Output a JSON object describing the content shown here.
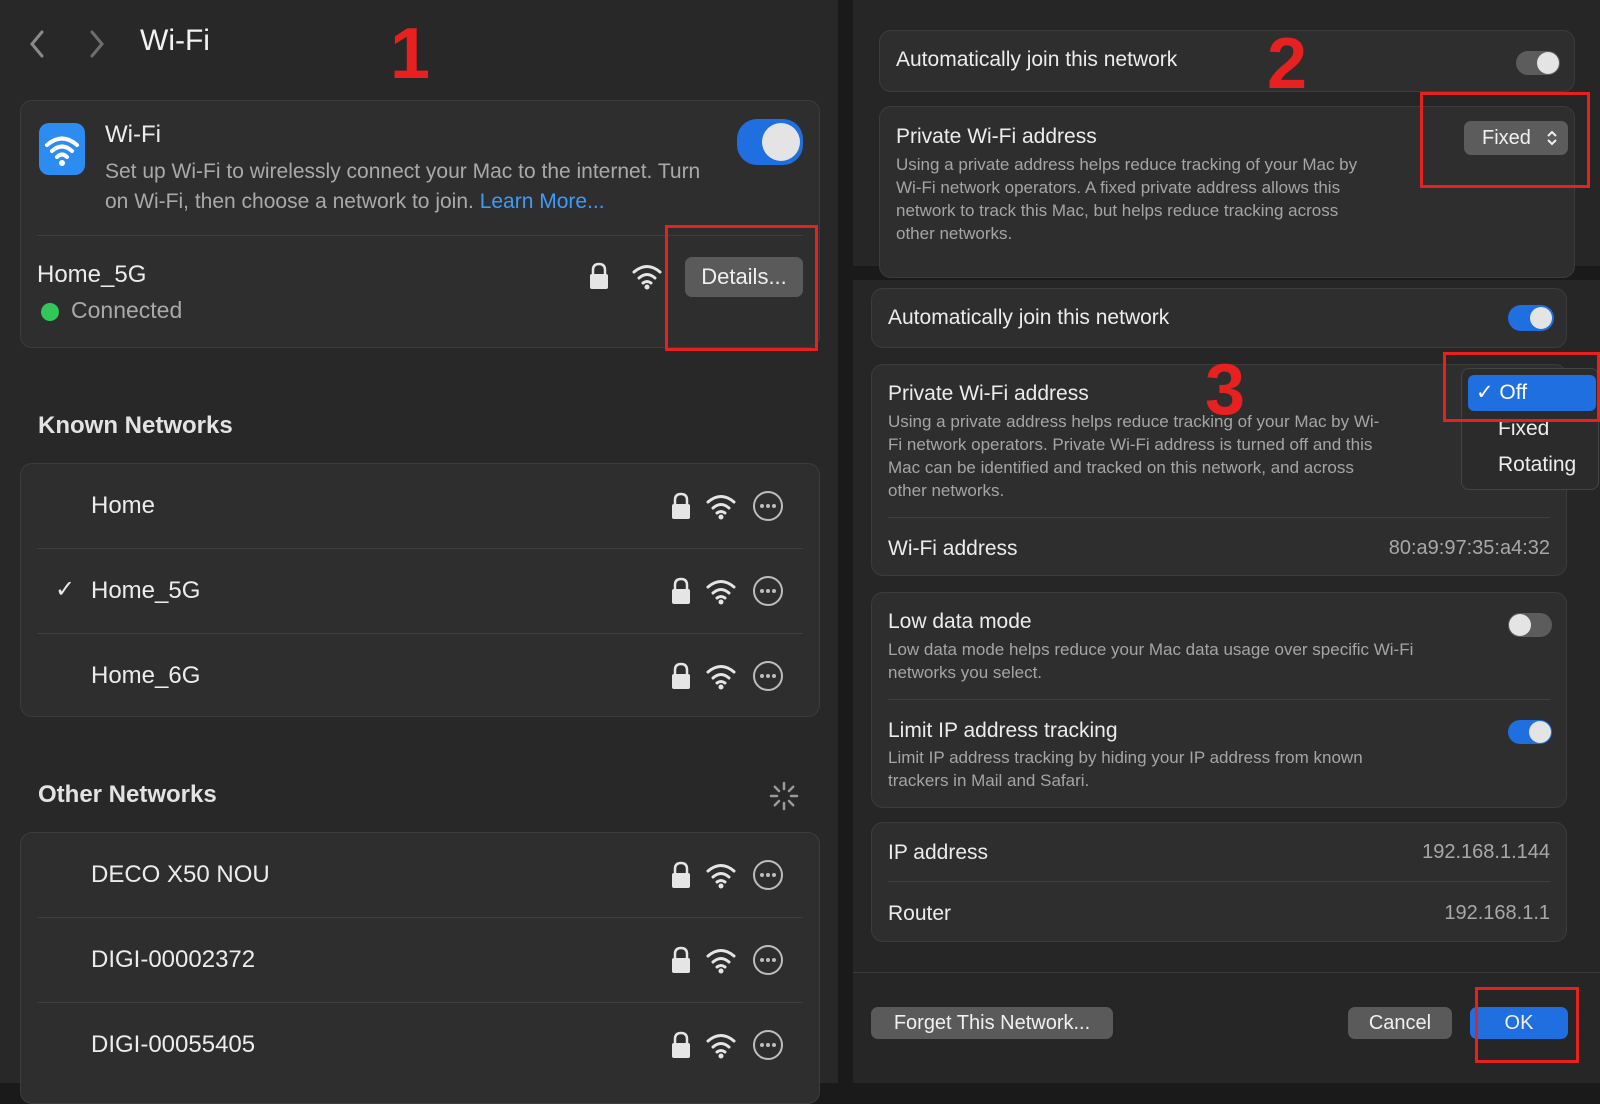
{
  "left": {
    "title": "Wi-Fi",
    "wifi_card": {
      "label": "Wi-Fi",
      "description_line1": "Set up Wi-Fi to wirelessly connect your Mac to the internet. Turn",
      "description_line2": "on Wi-Fi, then choose a network to join.",
      "learn_more": "Learn More...",
      "enabled": true
    },
    "current": {
      "name": "Home_5G",
      "status": "Connected",
      "details_label": "Details..."
    },
    "known_header": "Known Networks",
    "known": [
      {
        "name": "Home",
        "checked": ""
      },
      {
        "name": "Home_5G",
        "checked": "✓"
      },
      {
        "name": "Home_6G",
        "checked": ""
      }
    ],
    "other_header": "Other Networks",
    "other": [
      {
        "name": "DECO X50 NOU"
      },
      {
        "name": "DIGI-00002372"
      },
      {
        "name": "DIGI-00055405"
      }
    ]
  },
  "right_top": {
    "auto_join": "Automatically join this network",
    "private_label": "Private Wi-Fi address",
    "private_value": "Fixed",
    "private_desc": [
      "Using a private address helps reduce tracking of your Mac by",
      "Wi-Fi network operators. A fixed private address allows this",
      "network to track this Mac, but helps reduce tracking across",
      "other networks."
    ]
  },
  "right_main": {
    "auto_join": "Automatically join this network",
    "private_label": "Private Wi-Fi address",
    "private_desc": [
      "Using a private address helps reduce tracking of your Mac by Wi-",
      "Fi network operators. Private Wi-Fi address is turned off and this",
      "Mac can be identified and tracked on this network, and across",
      "other networks."
    ],
    "dropdown": {
      "selected": "✓ Off",
      "options": [
        "Fixed",
        "Rotating"
      ]
    },
    "wifi_address_label": "Wi-Fi address",
    "wifi_address": "80:a9:97:35:a4:32",
    "low_data_label": "Low data mode",
    "low_data_desc": [
      "Low data mode helps reduce your Mac data usage over specific Wi-Fi",
      "networks you select."
    ],
    "limit_ip_label": "Limit IP address tracking",
    "limit_ip_desc": [
      "Limit IP address tracking by hiding your IP address from known",
      "trackers in Mail and Safari."
    ],
    "ip_label": "IP address",
    "ip_value": "192.168.1.144",
    "router_label": "Router",
    "router_value": "192.168.1.1",
    "forget_label": "Forget This Network...",
    "cancel_label": "Cancel",
    "ok_label": "OK"
  },
  "steps": [
    "1",
    "2",
    "3"
  ],
  "colors": {
    "accent": "#1f6fe0",
    "annotation": "#e6211f",
    "connected": "#31c759"
  }
}
